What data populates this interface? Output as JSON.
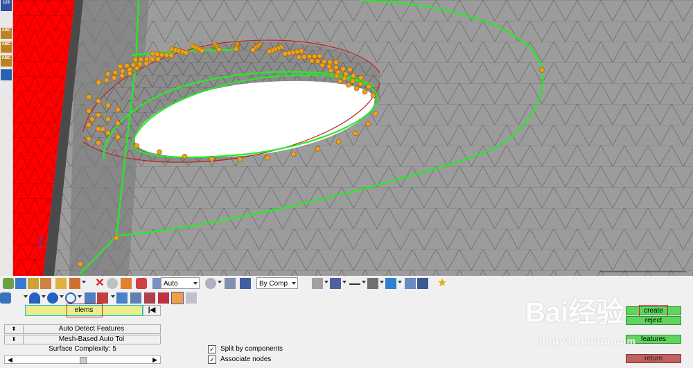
{
  "toolbar": {
    "auto_label": "Auto",
    "bycomp_label": "By Comp"
  },
  "left_tools": [
    {
      "name": "info-icon",
      "label": "123"
    },
    {
      "name": "abc-icon-1",
      "label": "ABC"
    },
    {
      "name": "abc-icon-2",
      "label": "ABC"
    },
    {
      "name": "abc-icon-3",
      "label": "ABC"
    }
  ],
  "panel": {
    "selector_label": "elems",
    "auto_detect_label": "Auto Detect Features",
    "mesh_tol_label": "Mesh-Based Auto Tol",
    "surface_complexity_label": "Surface Complexity:",
    "surface_complexity_value": "5",
    "split_label": "Split by components",
    "associate_label": "Associate nodes",
    "create_label": "create",
    "reject_label": "reject",
    "features_label": "features",
    "return_label": "return"
  },
  "watermark": {
    "main": "Bai经验",
    "sub": "jingyan.baidu.com"
  },
  "colors": {
    "mesh_fill": "#9a9a9a",
    "red_component": "#ff0000",
    "feature_line": "#22dd22",
    "node": "#f0a020",
    "hole": "#ffffff",
    "accent_green": "#5fd45f",
    "return_red": "#c06060"
  }
}
